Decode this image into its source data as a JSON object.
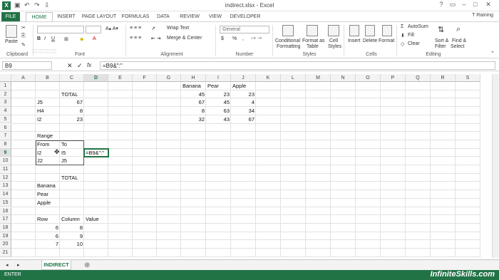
{
  "window": {
    "title": "indirect.xlsx - Excel",
    "app_icon": "X",
    "user": "T Raining"
  },
  "ribbon_tabs": [
    "FILE",
    "HOME",
    "INSERT",
    "PAGE LAYOUT",
    "FORMULAS",
    "DATA",
    "REVIEW",
    "VIEW",
    "DEVELOPER"
  ],
  "active_tab": "HOME",
  "ribbon": {
    "clipboard": {
      "paste": "Paste",
      "label": "Clipboard"
    },
    "font": {
      "label": "Font"
    },
    "alignment": {
      "wrap": "Wrap Text",
      "merge": "Merge & Center",
      "label": "Alignment"
    },
    "number": {
      "format": "General",
      "label": "Number",
      "currency": "$",
      "percent": "%",
      "comma": ","
    },
    "styles": {
      "conditional": "Conditional",
      "conditional2": "Formatting",
      "format_as": "Format as",
      "format_as2": "Table",
      "cell_styles": "Cell",
      "cell_styles2": "Styles",
      "label": "Styles"
    },
    "cells": {
      "insert": "Insert",
      "delete": "Delete",
      "format": "Format",
      "label": "Cells"
    },
    "editing": {
      "autosum": "AutoSum",
      "fill": "Fill",
      "clear": "Clear",
      "sort": "Sort &",
      "sort2": "Filter",
      "find": "Find &",
      "find2": "Select",
      "label": "Editing"
    }
  },
  "formula_bar": {
    "name_box": "B9",
    "formula": "=B9&\":\""
  },
  "columns": [
    "A",
    "B",
    "C",
    "D",
    "E",
    "F",
    "G",
    "H",
    "I",
    "J",
    "K",
    "L",
    "M",
    "N",
    "O",
    "P",
    "Q",
    "R",
    "S"
  ],
  "active_col": "D",
  "active_row": "9",
  "rows": [
    "1",
    "2",
    "3",
    "4",
    "5",
    "6",
    "7",
    "8",
    "9",
    "10",
    "11",
    "12",
    "13",
    "14",
    "15",
    "16",
    "17",
    "18",
    "19",
    "20",
    "21"
  ],
  "cells": {
    "C2": "TOTAL",
    "B3": "J5",
    "C3": "67",
    "B4": "H4",
    "C4": "8",
    "B5": "I2",
    "C5": "23",
    "H1": "Banana",
    "I1": "Pear",
    "J1": "Apple",
    "H2": "45",
    "I2": "23",
    "J2": "23",
    "H3": "67",
    "I3": "45",
    "J3": "4",
    "H4": "8",
    "I4": "63",
    "J4": "34",
    "H5": "32",
    "I5": "43",
    "J5": "67",
    "B7": "Range",
    "B8": "From",
    "C8": "To",
    "B9": "I2",
    "C9": "I5",
    "D9": "=B9&\":\"",
    "B10": "J2",
    "C10": "J5",
    "C12": "TOTAL",
    "B13": "Banana",
    "B14": "Pear",
    "B15": "Apple",
    "B17": "Row",
    "C17": "Column",
    "D17": "Value",
    "B18": "6",
    "C18": "8",
    "B19": "6",
    "C19": "9",
    "B20": "7",
    "C20": "10"
  },
  "sheet": {
    "tab": "INDIRECT",
    "add": "⊕"
  },
  "status": {
    "mode": "ENTER",
    "watermark": "InfiniteSkills.com"
  },
  "colors": {
    "accent": "#217346"
  }
}
